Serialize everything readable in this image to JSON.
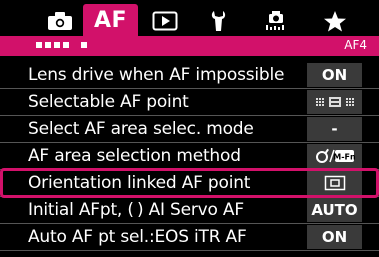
{
  "tabs": [
    {
      "id": "shoot",
      "icon": "camera-icon"
    },
    {
      "id": "af",
      "label": "AF"
    },
    {
      "id": "play",
      "icon": "play-icon"
    },
    {
      "id": "setup",
      "icon": "wrench-icon"
    },
    {
      "id": "custom",
      "icon": "custom-functions-icon"
    },
    {
      "id": "mymenu",
      "icon": "star-icon"
    }
  ],
  "page_dots_count": 6,
  "page_current_index": 4,
  "page_code": "AF4",
  "rows": [
    {
      "label": "Lens drive when AF impossible",
      "value": "ON"
    },
    {
      "label": "Selectable AF point",
      "value": "",
      "value_icon": "af-point-grid-icon"
    },
    {
      "label": "Select AF area selec. mode",
      "value": "-"
    },
    {
      "label": "AF area selection method",
      "value": "",
      "value_icon": "m-fn-button-icon"
    },
    {
      "label": "Orientation linked AF point",
      "value": "",
      "value_icon": "single-af-point-icon",
      "selected": true
    },
    {
      "label": "Initial AFpt, ( ) AI Servo AF",
      "value": "AUTO"
    },
    {
      "label": "Auto AF pt sel.:EOS iTR AF",
      "value": "ON"
    }
  ],
  "colors": {
    "accent": "#d2116a",
    "value_bg": "#3a3a3a"
  }
}
